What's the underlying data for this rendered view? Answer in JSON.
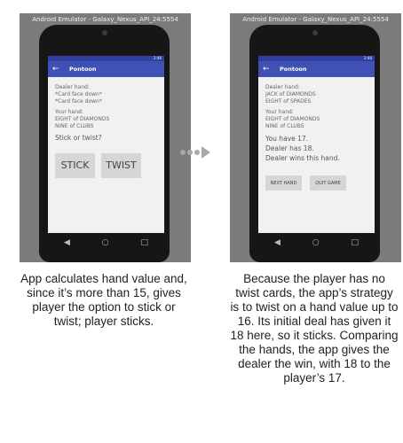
{
  "left": {
    "emulator_title": "Android Emulator - Galaxy_Nexus_API_24:5554",
    "status_time": "2:46",
    "app_title": "Pontoon",
    "dealer_label": "Dealer hand:",
    "dealer_cards": [
      "*Card face down*",
      "*Card face down*"
    ],
    "your_label": "Your hand:",
    "your_cards": [
      "EIGHT of DIAMONDS",
      "NINE of CLUBS"
    ],
    "question": "Stick or twist?",
    "stick_label": "STICK",
    "twist_label": "TWIST",
    "caption": "App calculates hand value and, since it’s more than 15, gives player the option to stick or twist; player sticks."
  },
  "right": {
    "emulator_title": "Android Emulator - Galaxy_Nexus_API_24:5554",
    "status_time": "2:46",
    "app_title": "Pontoon",
    "dealer_label": "Dealer hand:",
    "dealer_cards": [
      "JACK of DIAMONDS",
      "EIGHT of SPADES"
    ],
    "your_label": "Your hand:",
    "your_cards": [
      "EIGHT of DIAMONDS",
      "NINE of CLUBS"
    ],
    "results": [
      "You have 17.",
      "Dealer has 18.",
      "Dealer wins this hand."
    ],
    "next_hand_label": "NEXT HAND",
    "quit_game_label": "QUIT GAME",
    "caption": "Because the player has no twist cards, the app’s strategy is to twist on a hand value up to 16. Its initial deal has given it 18 here, so it sticks. Comparing the hands, the app gives the dealer the win, with 18 to the player’s 17."
  },
  "icons": [
    "back-arrow-icon",
    "nav-back-icon",
    "nav-home-icon",
    "nav-recents-icon",
    "transition-arrow-icon"
  ]
}
